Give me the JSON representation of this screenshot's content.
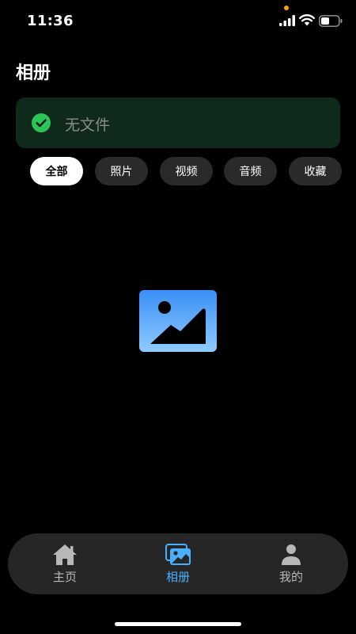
{
  "status_bar": {
    "time": "11:36",
    "icons": [
      "orange-dot-indicator",
      "cellular-signal-icon",
      "wifi-icon",
      "battery-icon"
    ]
  },
  "header": {
    "title": "相册"
  },
  "banner": {
    "text": "无文件",
    "icon": "check-circle-icon",
    "accent": "#2fc45a"
  },
  "filters": {
    "items": [
      {
        "label": "全部",
        "selected": true
      },
      {
        "label": "照片",
        "selected": false
      },
      {
        "label": "视频",
        "selected": false
      },
      {
        "label": "音频",
        "selected": false
      },
      {
        "label": "收藏",
        "selected": false
      }
    ]
  },
  "empty_state": {
    "icon": "image-placeholder-icon"
  },
  "tabbar": {
    "items": [
      {
        "label": "主页",
        "icon": "home-icon",
        "active": false
      },
      {
        "label": "相册",
        "icon": "photos-icon",
        "active": true
      },
      {
        "label": "我的",
        "icon": "user-icon",
        "active": false
      }
    ],
    "active_color": "#4ab0ff"
  }
}
